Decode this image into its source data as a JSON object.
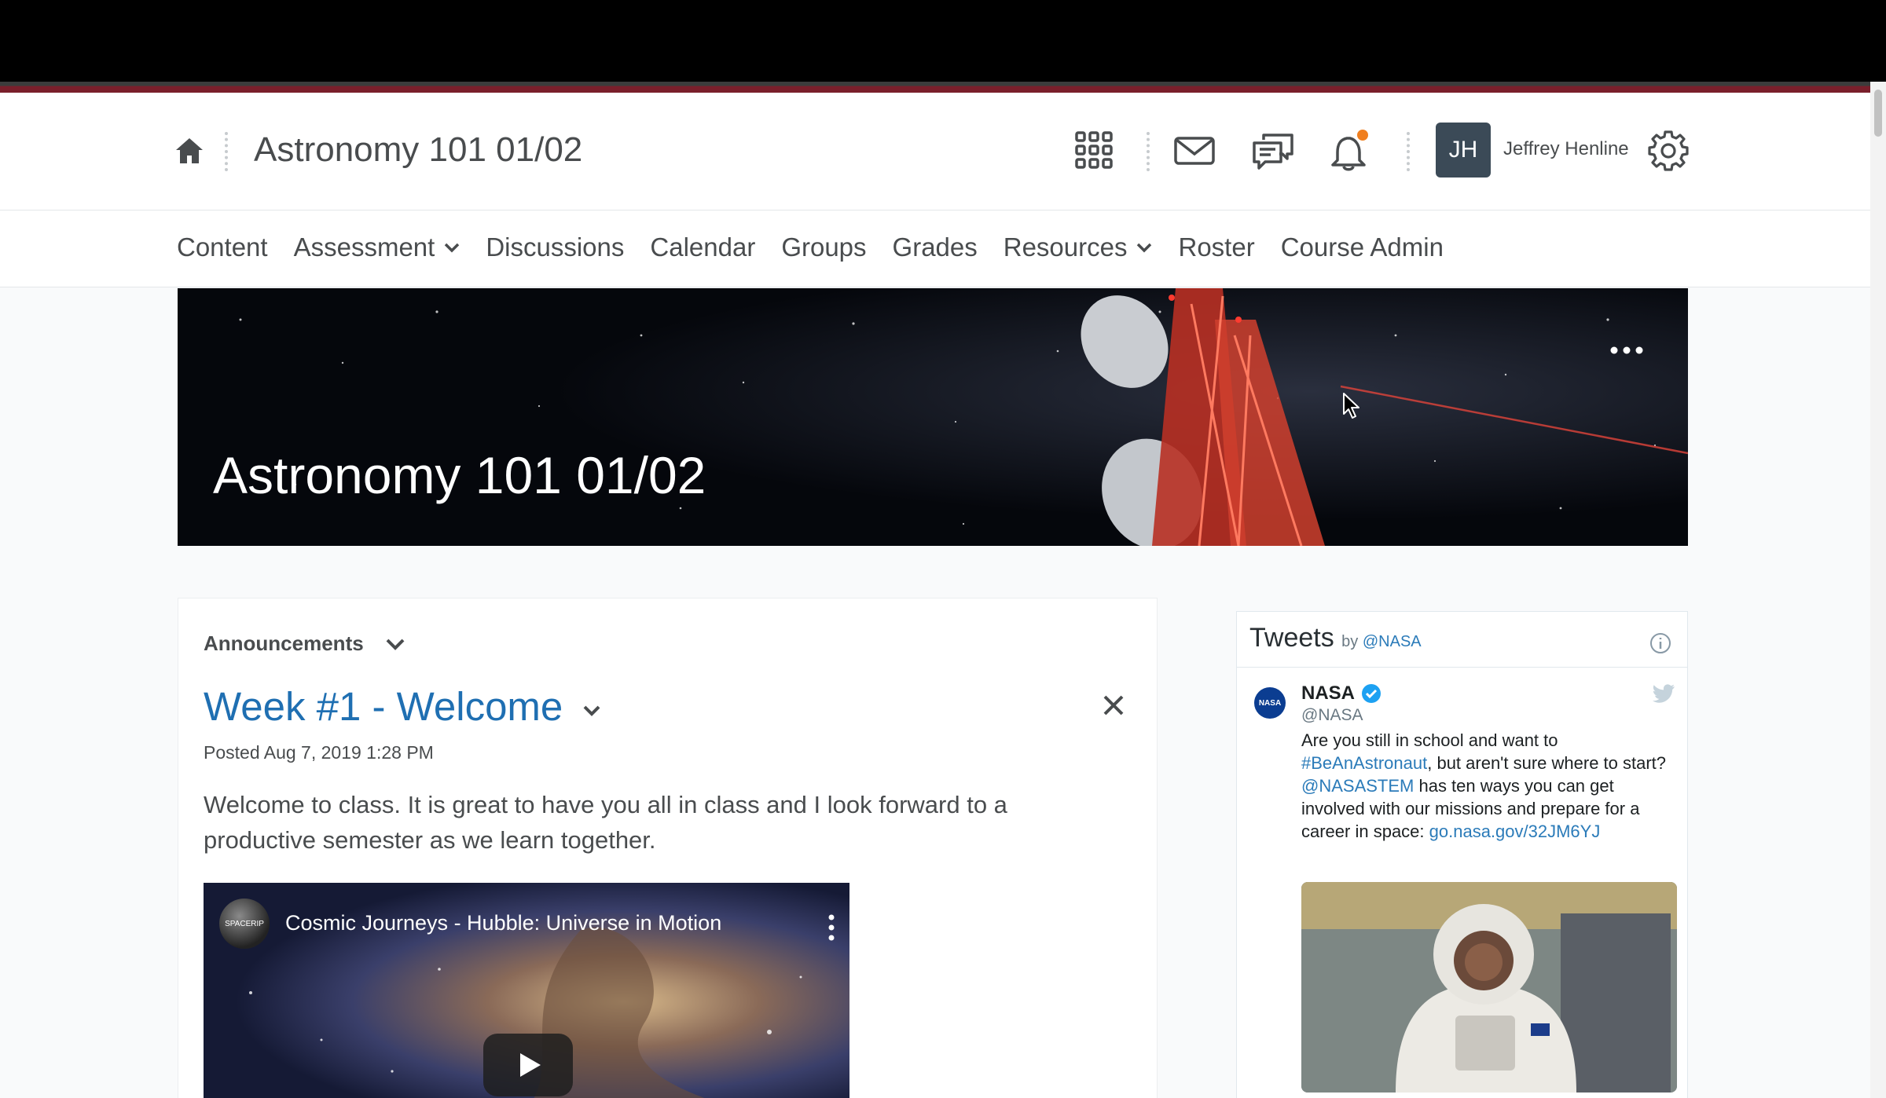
{
  "header": {
    "course_title": "Astronomy 101 01/02",
    "user_initials": "JH",
    "user_name": "Jeffrey Henline",
    "icons": [
      "home-icon",
      "waffle-grid-icon",
      "email-icon",
      "chat-icon",
      "bell-icon",
      "gear-icon"
    ]
  },
  "navbar": {
    "items": [
      {
        "label": "Content"
      },
      {
        "label": "Assessment"
      },
      {
        "label": "Discussions"
      },
      {
        "label": "Calendar"
      },
      {
        "label": "Groups"
      },
      {
        "label": "Grades"
      },
      {
        "label": "Resources"
      },
      {
        "label": "Roster"
      },
      {
        "label": "Course Admin"
      }
    ]
  },
  "banner": {
    "title": "Astronomy 101 01/02"
  },
  "announcements": {
    "widget_title": "Announcements",
    "item": {
      "title": "Week #1 - Welcome",
      "posted": "Posted Aug 7, 2019 1:28 PM",
      "body": "Welcome to class. It is great to have you all in class and I look forward to a productive semester as we learn together.",
      "video": {
        "title": "Cosmic Journeys - Hubble: Universe in Motion",
        "channel_logo_text": "SPACERIP"
      }
    }
  },
  "tweets": {
    "title": "Tweets",
    "by": "by",
    "handle": "@NASA",
    "tweet": {
      "avatar_text": "NASA",
      "name": "NASA",
      "screen_name": "@NASA",
      "text_1": "Are you still in school and want to ",
      "hashtag": "#BeAnAstronaut",
      "text_2": ", but aren't sure where to start?  ",
      "mention": "@NASASTEM",
      "text_3": " has ten ways you can get involved with our missions and prepare for a career in space: ",
      "link": "go.nasa.gov/32JM6YJ"
    }
  },
  "colors": {
    "link_blue": "#1f6fb2",
    "accent_maroon": "#7a1f2b",
    "notification_orange": "#f07f1f",
    "avatar_bg": "#3b4a57"
  }
}
